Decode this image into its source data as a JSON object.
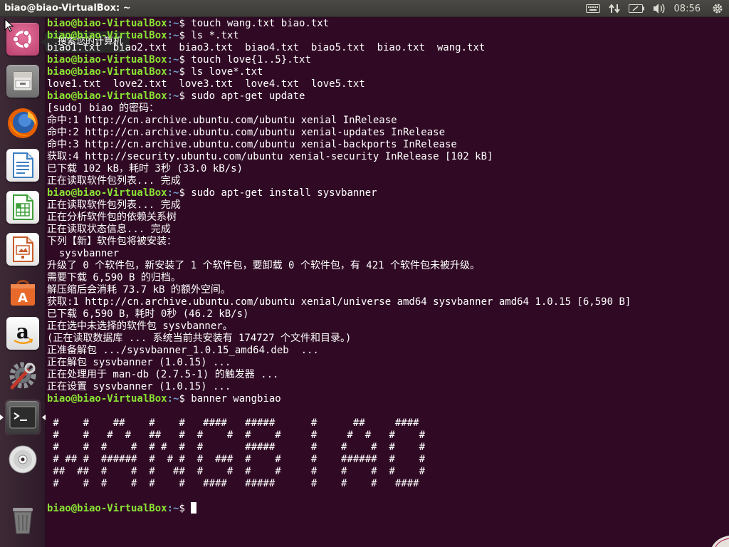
{
  "panel": {
    "title": "biao@biao-VirtualBox: ~",
    "clock": "08:56",
    "indicators": [
      "keyboard-icon",
      "network-arrows-icon",
      "battery-icon",
      "volume-icon",
      "gear-icon"
    ]
  },
  "tooltip": {
    "text": "搜索您的计算机"
  },
  "launcher": {
    "items": [
      {
        "name": "dash-search",
        "icon": "ubuntu-logo-icon"
      },
      {
        "name": "files",
        "icon": "file-cabinet-icon"
      },
      {
        "name": "firefox",
        "icon": "firefox-icon"
      },
      {
        "name": "libreoffice-writer",
        "icon": "writer-document-icon"
      },
      {
        "name": "libreoffice-calc",
        "icon": "calc-spreadsheet-icon"
      },
      {
        "name": "libreoffice-impress",
        "icon": "impress-presentation-icon"
      },
      {
        "name": "ubuntu-software",
        "icon": "software-bag-icon"
      },
      {
        "name": "amazon",
        "icon": "amazon-icon"
      },
      {
        "name": "system-settings",
        "icon": "settings-gear-wrench-icon"
      },
      {
        "name": "terminal",
        "icon": "terminal-icon"
      },
      {
        "name": "dvd",
        "icon": "disc-icon"
      },
      {
        "name": "trash",
        "icon": "trash-icon"
      }
    ],
    "colors": {
      "dash": "#cf4f7d",
      "files": "#8a8a8a",
      "firefox": "#2c6fb5",
      "writer": "#3d7fc2",
      "calc": "#3f9f3b",
      "impress": "#c75a28",
      "software": "#e86a2a",
      "amazon": "#f2f2f2",
      "settings": "#555a5e",
      "terminal": "#2f2f2f",
      "dvd": "#d9d9d9",
      "trash": "#5a5a5a"
    }
  },
  "terminal": {
    "prompt_user": "biao@biao-VirtualBox",
    "prompt_path": ":~",
    "lines": [
      {
        "type": "prompt",
        "cmd": "touch wang.txt biao.txt"
      },
      {
        "type": "prompt",
        "cmd": "ls *.txt"
      },
      {
        "type": "out",
        "text": "biao1.txt  biao2.txt  biao3.txt  biao4.txt  biao5.txt  biao.txt  wang.txt"
      },
      {
        "type": "prompt",
        "cmd": "touch love{1..5}.txt"
      },
      {
        "type": "prompt",
        "cmd": "ls love*.txt"
      },
      {
        "type": "out",
        "text": "love1.txt  love2.txt  love3.txt  love4.txt  love5.txt"
      },
      {
        "type": "prompt",
        "cmd": "sudo apt-get update"
      },
      {
        "type": "out",
        "text": "[sudo] biao 的密码："
      },
      {
        "type": "out",
        "text": "命中:1 http://cn.archive.ubuntu.com/ubuntu xenial InRelease"
      },
      {
        "type": "out",
        "text": "命中:2 http://cn.archive.ubuntu.com/ubuntu xenial-updates InRelease"
      },
      {
        "type": "out",
        "text": "命中:3 http://cn.archive.ubuntu.com/ubuntu xenial-backports InRelease"
      },
      {
        "type": "out",
        "text": "获取:4 http://security.ubuntu.com/ubuntu xenial-security InRelease [102 kB]"
      },
      {
        "type": "out",
        "text": "已下载 102 kB，耗时 3秒 (33.0 kB/s)"
      },
      {
        "type": "out",
        "text": "正在读取软件包列表... 完成"
      },
      {
        "type": "prompt",
        "cmd": "sudo apt-get install sysvbanner"
      },
      {
        "type": "out",
        "text": "正在读取软件包列表... 完成"
      },
      {
        "type": "out",
        "text": "正在分析软件包的依赖关系树"
      },
      {
        "type": "out",
        "text": "正在读取状态信息... 完成"
      },
      {
        "type": "out",
        "text": "下列【新】软件包将被安装："
      },
      {
        "type": "out",
        "text": "  sysvbanner"
      },
      {
        "type": "out",
        "text": "升级了 0 个软件包，新安装了 1 个软件包，要卸载 0 个软件包，有 421 个软件包未被升级。"
      },
      {
        "type": "out",
        "text": "需要下载 6,590 B 的归档。"
      },
      {
        "type": "out",
        "text": "解压缩后会消耗 73.7 kB 的额外空间。"
      },
      {
        "type": "out",
        "text": "获取:1 http://cn.archive.ubuntu.com/ubuntu xenial/universe amd64 sysvbanner amd64 1.0.15 [6,590 B]"
      },
      {
        "type": "out",
        "text": "已下载 6,590 B，耗时 0秒 (46.2 kB/s)"
      },
      {
        "type": "out",
        "text": "正在选中未选择的软件包 sysvbanner。"
      },
      {
        "type": "out",
        "text": "(正在读取数据库 ... 系统当前共安装有 174727 个文件和目录。)"
      },
      {
        "type": "out",
        "text": "正准备解包 .../sysvbanner_1.0.15_amd64.deb  ..."
      },
      {
        "type": "out",
        "text": "正在解包 sysvbanner (1.0.15) ..."
      },
      {
        "type": "out",
        "text": "正在处理用于 man-db (2.7.5-1) 的触发器 ..."
      },
      {
        "type": "out",
        "text": "正在设置 sysvbanner (1.0.15) ..."
      },
      {
        "type": "prompt",
        "cmd": "banner wangbiao"
      },
      {
        "type": "out",
        "text": ""
      },
      {
        "type": "out",
        "text": " #    #    ##    #    #   ####   #####      #      ##     ####"
      },
      {
        "type": "out",
        "text": " #    #   #  #   ##   #  #    #  #    #     #     #  #   #    #"
      },
      {
        "type": "out",
        "text": " #    #  #    #  # #  #  #       #####      #    #    #  #    #"
      },
      {
        "type": "out",
        "text": " # ## #  ######  #  # #  #  ###  #    #     #    ######  #    #"
      },
      {
        "type": "out",
        "text": " ##  ##  #    #  #   ##  #    #  #    #     #    #    #  #    #"
      },
      {
        "type": "out",
        "text": " #    #  #    #  #    #   ####   #####      #    #    #   ####"
      },
      {
        "type": "out",
        "text": ""
      },
      {
        "type": "prompt",
        "cmd": "",
        "cursor": true
      }
    ]
  }
}
